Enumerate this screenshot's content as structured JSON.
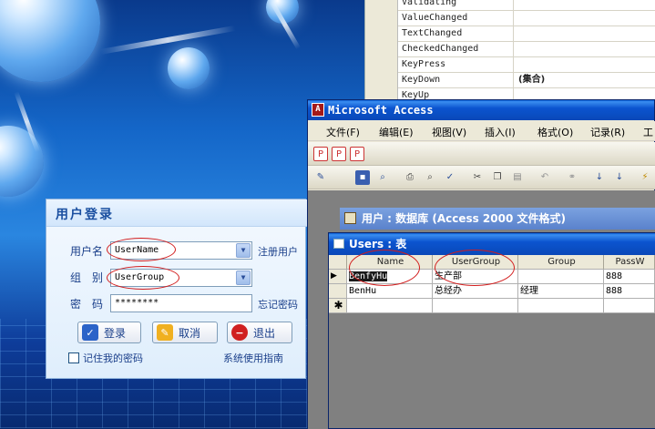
{
  "properties": {
    "rows": [
      {
        "key": "Validating",
        "value": ""
      },
      {
        "key": "ValueChanged",
        "value": ""
      },
      {
        "key": "TextChanged",
        "value": ""
      },
      {
        "key": "CheckedChanged",
        "value": ""
      },
      {
        "key": "KeyPress",
        "value": ""
      },
      {
        "key": "KeyDown",
        "value": "(集合)"
      },
      {
        "key": "KeyUp",
        "value": ""
      }
    ]
  },
  "login": {
    "title": "用户登录",
    "username_label": "用户名",
    "username_value": "UserName",
    "group_label": "组　别",
    "group_value": "UserGroup",
    "password_label": "密　码",
    "password_value": "********",
    "register_link": "注册用户",
    "forgot_link": "忘记密码",
    "login_button": "登录",
    "cancel_button": "取消",
    "exit_button": "退出",
    "remember_label": "记住我的密码",
    "guide_link": "系统使用指南"
  },
  "access": {
    "title": "Microsoft Access",
    "menu": [
      "文件(F)",
      "编辑(E)",
      "视图(V)",
      "插入(I)",
      "格式(O)",
      "记录(R)",
      "工"
    ],
    "db_window_title": "用户 : 数据库 (Access 2000 文件格式)",
    "table_window_title": "Users : 表",
    "columns": [
      "Name",
      "UserGroup",
      "Group",
      "PassW"
    ],
    "rows": [
      [
        "BenfyHu",
        "生产部",
        "",
        "888"
      ],
      [
        "BenHu",
        "总经办",
        "经理",
        "888"
      ]
    ]
  }
}
